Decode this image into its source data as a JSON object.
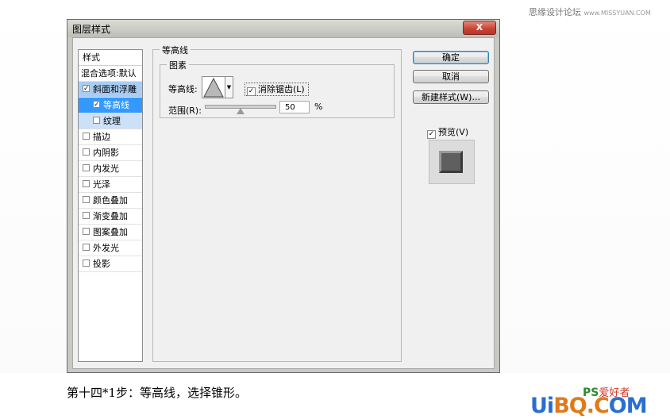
{
  "watermark_top": {
    "text": "思缘设计论坛",
    "site": "www.MISSYUAN.COM"
  },
  "window": {
    "title": "图层样式",
    "close_label": "X"
  },
  "left_panel": {
    "header": "样式",
    "blend_options": "混合选项:默认",
    "items": [
      {
        "label": "斜面和浮雕",
        "checked": true
      },
      {
        "label": "等高线",
        "checked": true
      },
      {
        "label": "纹理",
        "checked": false
      },
      {
        "label": "描边",
        "checked": false
      },
      {
        "label": "内阴影",
        "checked": false
      },
      {
        "label": "内发光",
        "checked": false
      },
      {
        "label": "光泽",
        "checked": false
      },
      {
        "label": "颜色叠加",
        "checked": false
      },
      {
        "label": "渐变叠加",
        "checked": false
      },
      {
        "label": "图案叠加",
        "checked": false
      },
      {
        "label": "外发光",
        "checked": false
      },
      {
        "label": "投影",
        "checked": false
      }
    ]
  },
  "contour_panel": {
    "group_title": "等高线",
    "subgroup_title": "图素",
    "contour_label": "等高线:",
    "antialias_label": "消除锯齿(L)",
    "antialias_checked": true,
    "range_label": "范围(R):",
    "range_value": "50",
    "range_unit": "%",
    "range_fraction": 0.5
  },
  "buttons": {
    "ok": "确定",
    "cancel": "取消",
    "new_style": "新建样式(W)...",
    "preview_label": "预览(V)",
    "preview_checked": true
  },
  "caption": "第十四*1步：等高线，选择锥形。",
  "watermark_bottom": {
    "ps": "PS",
    "ai": "爱好者",
    "brand_u": "Ui",
    "brand_b": "BQ.C",
    "brand_rest": "OM"
  },
  "colors": {
    "selected_dark": "#3399ff",
    "selected_light": "#a9cdf2",
    "close_button": "#c64232"
  }
}
